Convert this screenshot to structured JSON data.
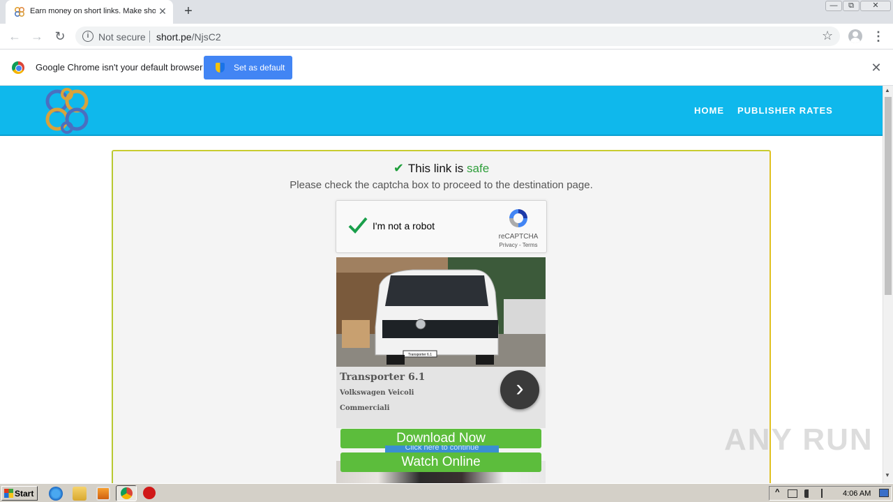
{
  "browser": {
    "tab_title": "Earn money on short links. Make short links and earn the biggest money",
    "tab_close": "✕",
    "new_tab": "+",
    "window_controls": {
      "minimize": "—",
      "restore": "⧉",
      "close": "✕"
    },
    "back": "←",
    "forward": "→",
    "reload": "↻",
    "security_icon": "i",
    "security_label": "Not secure",
    "url_host": "short.pe",
    "url_path": "/NjsC2",
    "bookmark_star": "☆",
    "menu": "⋮"
  },
  "infobar": {
    "message": "Google Chrome isn't your default browser",
    "button_label": "Set as default",
    "close": "✕"
  },
  "site": {
    "nav": {
      "home": "HOME",
      "publisher_rates": "PUBLISHER RATES"
    },
    "colors": {
      "header": "#0fb8ec",
      "safe": "#2e9e3a",
      "button": "#5cbd3c",
      "card_border": "#e0c020"
    },
    "safe_check": "✔",
    "safe_prefix": "This link is",
    "safe_word": "safe",
    "instruction": "Please check the captcha box to proceed to the destination page.",
    "recaptcha": {
      "label": "I'm not a robot",
      "brand": "reCAPTCHA",
      "links": "Privacy - Terms"
    },
    "ad": {
      "title": "Transporter 6.1",
      "subtitle_line1": "Volkswagen Veicoli",
      "subtitle_line2": "Commerciali",
      "arrow": "›",
      "plate_text": "Transporter 6.1"
    },
    "buttons": {
      "download": "Download Now",
      "continue": "Click here to continue",
      "watch": "Watch Online"
    }
  },
  "watermark": "ANY RUN",
  "taskbar": {
    "start_label": "Start",
    "clock": "4:06 AM",
    "tray_expand": "^"
  }
}
